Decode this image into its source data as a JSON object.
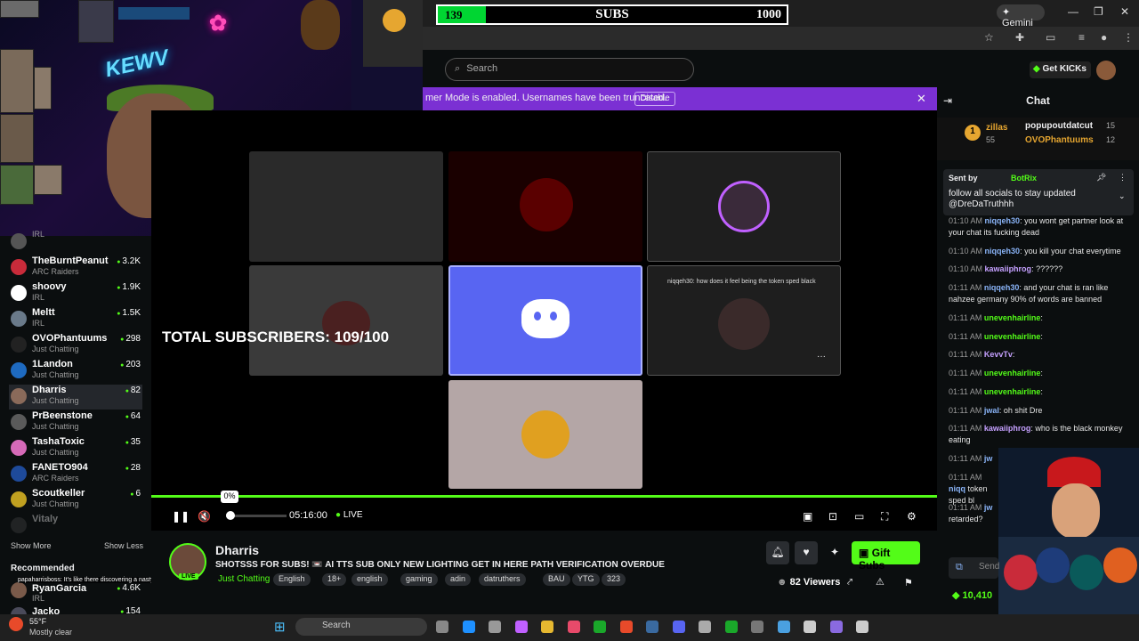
{
  "subs_goal": {
    "current": "139",
    "label": "SUBS",
    "target": "1000",
    "progress": 0.139
  },
  "browser": {
    "gemini_label": "Gemini",
    "min": "—",
    "max": "❐",
    "close": "✕"
  },
  "header": {
    "search_placeholder": "Search",
    "get_kicks": "Get KICKs"
  },
  "banner": {
    "text": "mer Mode is enabled. Usernames have been truncated.",
    "disable": "Disable",
    "close": "✕"
  },
  "webcam": {
    "neon_text": "✿",
    "wall_text": "KEWV"
  },
  "sidebar": {
    "channels": [
      {
        "name": "IRL",
        "category": "",
        "count": ""
      },
      {
        "name": "TheBurntPeanut",
        "category": "ARC Raiders",
        "count": "3.2K"
      },
      {
        "name": "shoovy",
        "category": "IRL",
        "count": "1.9K"
      },
      {
        "name": "Meltt",
        "category": "IRL",
        "count": "1.5K"
      },
      {
        "name": "OVOPhantuums",
        "category": "Just Chatting",
        "count": "298"
      },
      {
        "name": "1Landon",
        "category": "Just Chatting",
        "count": "203"
      },
      {
        "name": "Dharris",
        "category": "Just Chatting",
        "count": "82"
      },
      {
        "name": "PrBeenstone",
        "category": "Just Chatting",
        "count": "64"
      },
      {
        "name": "TashaToxic",
        "category": "Just Chatting",
        "count": "35"
      },
      {
        "name": "FANETO904",
        "category": "ARC Raiders",
        "count": "28"
      },
      {
        "name": "Scoutkeller",
        "category": "Just Chatting",
        "count": "6"
      },
      {
        "name": "Vitaly",
        "category": "",
        "count": ""
      }
    ],
    "show_more": "Show More",
    "show_less": "Show Less",
    "recommended": "Recommended",
    "rec_channels": [
      {
        "name": "RyanGarcia",
        "category": "IRL",
        "count": "4.6K"
      },
      {
        "name": "Jacko",
        "category": "",
        "count": "154"
      }
    ],
    "overlay_chat": "papaharrisboss: It's like there discovering a nasty poopy gorilla in the zoo lmao"
  },
  "video": {
    "total_subs": "TOTAL SUBSCRIBERS: 109/100",
    "tile_caption": "niqqeh30: how does it feel being the token sped black",
    "tile_more": "···"
  },
  "player": {
    "pause": "❚❚",
    "mute": "🔇",
    "volume_badge": "0%",
    "time": "05:16:00",
    "live": "LIVE"
  },
  "stream": {
    "name": "Dharris",
    "title": "SHOTSSS FOR SUBS! 📼 AI TTS SUB ONLY NEW LIGHTING GET IN HERE PATH VERIFICATION  OVERDUE",
    "category": "Just Chatting",
    "avatar_badge": "LIVE",
    "tags": [
      "English",
      "18+",
      "english",
      "gaming",
      "adin",
      "datruthers",
      "BAU",
      "YTG",
      "323"
    ],
    "gift_subs": "Gift Subs",
    "viewers": "82 Viewers"
  },
  "chat": {
    "title": "Chat",
    "leaderboard": [
      {
        "rank": "1",
        "name": "zillas",
        "score": "55"
      },
      {
        "name": "popupoutdatcut",
        "score": "15"
      },
      {
        "name": "OVOPhantuums",
        "score": "12"
      }
    ],
    "pinned": {
      "sent_by": "Sent by",
      "bot": "BotRix",
      "text": "follow all socials to stay updated @DreDaTruthhh"
    },
    "messages": [
      {
        "time": "01:10 AM",
        "user": "niqqeh30",
        "text": ": you wont get partner look at your chat its fucking dead"
      },
      {
        "time": "01:10 AM",
        "user": "niqqeh30",
        "text": ": you kill your chat everytime"
      },
      {
        "time": "01:10 AM",
        "user": "kawaiiphrog",
        "text": ": ??????"
      },
      {
        "time": "01:11 AM",
        "user": "niqqeh30",
        "text": ": and your chat is ran like nahzee germany 90% of words are banned"
      },
      {
        "time": "01:11 AM",
        "user": "unevenhairline",
        "text": ":"
      },
      {
        "time": "01:11 AM",
        "user": "unevenhairline",
        "text": ":"
      },
      {
        "time": "01:11 AM",
        "user": "KevvTv",
        "text": ":"
      },
      {
        "time": "01:11 AM",
        "user": "unevenhairline",
        "text": ":"
      },
      {
        "time": "01:11 AM",
        "user": "unevenhairline",
        "text": ":"
      },
      {
        "time": "01:11 AM",
        "user": "jwal",
        "text": ": oh shit Dre"
      },
      {
        "time": "01:11 AM",
        "user": "kawaiiphrog",
        "text": ": who is the black monkey eating"
      },
      {
        "time": "01:11 AM",
        "user": "jw",
        "text": ""
      },
      {
        "time": "01:11 AM",
        "user": "niqq",
        "text": " token sped bl"
      },
      {
        "time": "01:11 AM",
        "user": "jw",
        "text": " retarded?"
      }
    ],
    "send_placeholder": "Send",
    "kicks": "10,410"
  },
  "taskbar": {
    "weather_temp": "55°F",
    "weather_desc": "Mostly clear",
    "search": "Search"
  },
  "colors": {
    "kick_green": "#53fc18",
    "banner_purple": "#7b30d3",
    "discord_blue": "#5865f2"
  }
}
